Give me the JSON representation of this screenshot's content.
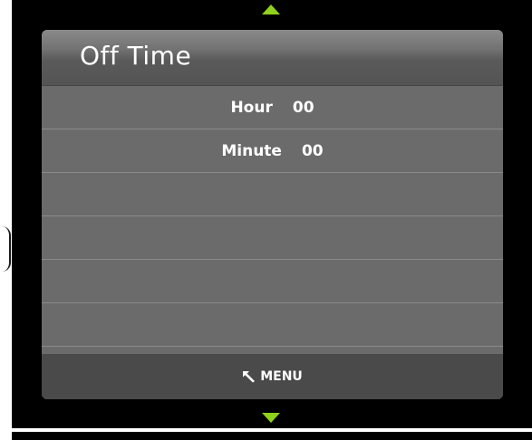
{
  "osd": {
    "title": "Off Time",
    "settings": [
      {
        "label": "Hour",
        "value": "00"
      },
      {
        "label": "Minute",
        "value": "00"
      }
    ],
    "empty_rows": 4,
    "footer": {
      "icon": "return-arrow-icon",
      "label": "MENU"
    },
    "colors": {
      "accent_arrow": "#8fd11c",
      "panel": "#6b6b6b",
      "footer": "#4a4a4a",
      "background": "#000000"
    }
  }
}
